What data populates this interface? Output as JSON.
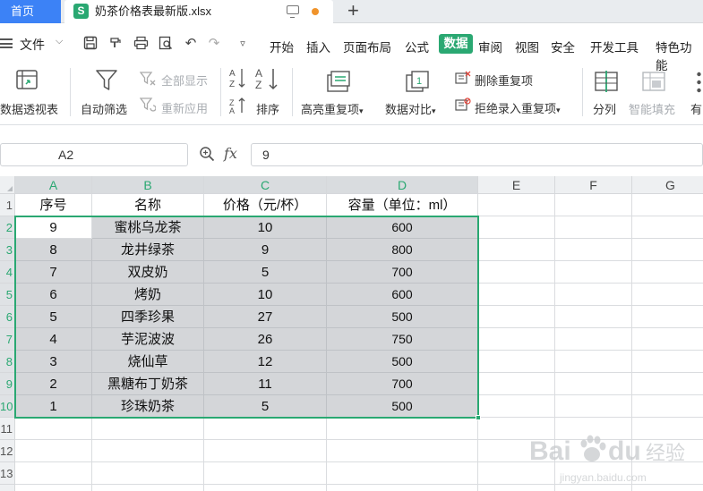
{
  "tabs": {
    "home_label": "首页",
    "file_icon_letter": "S",
    "file_name": "奶茶价格表最新版.xlsx",
    "new_tab_symbol": "+"
  },
  "menubar": {
    "file_label": "文件",
    "items": [
      "开始",
      "插入",
      "页面布局",
      "公式",
      "数据",
      "审阅",
      "视图",
      "安全",
      "开发工具",
      "特色功能"
    ],
    "active_item": "数据"
  },
  "ribbon": {
    "pivot_label": "数据透视表",
    "autofilter_label": "自动筛选",
    "show_all_label": "全部显示",
    "reapply_label": "重新应用",
    "sort_label": "排序",
    "highlight_dup_label": "高亮重复项",
    "compare_label": "数据对比",
    "remove_dup_label": "删除重复项",
    "reject_dup_label": "拒绝录入重复项",
    "split_label": "分列",
    "smart_fill_label": "智能填充",
    "more_label": "有",
    "dropdown_glyph": "▾"
  },
  "formula_bar": {
    "cell_ref": "A2",
    "fx_label": "fx",
    "value": "9"
  },
  "sheet": {
    "column_letters": [
      "A",
      "B",
      "C",
      "D",
      "E",
      "F",
      "G"
    ],
    "row_numbers": [
      "1",
      "2",
      "3",
      "4",
      "5",
      "6",
      "7",
      "8",
      "9",
      "10",
      "11",
      "12",
      "13",
      "14"
    ],
    "headers": [
      "序号",
      "名称",
      "价格（元/杯）",
      "容量（单位：ml）"
    ],
    "rows": [
      [
        "9",
        "蜜桃乌龙茶",
        "10",
        "600"
      ],
      [
        "8",
        "龙井绿茶",
        "9",
        "800"
      ],
      [
        "7",
        "双皮奶",
        "5",
        "700"
      ],
      [
        "6",
        "烤奶",
        "10",
        "600"
      ],
      [
        "5",
        "四季珍果",
        "27",
        "500"
      ],
      [
        "4",
        "芋泥波波",
        "26",
        "750"
      ],
      [
        "3",
        "烧仙草",
        "12",
        "500"
      ],
      [
        "2",
        "黑糖布丁奶茶",
        "11",
        "700"
      ],
      [
        "1",
        "珍珠奶茶",
        "5",
        "500"
      ]
    ],
    "active_cell": "A2",
    "selected_range": "A2:D10"
  },
  "watermark": {
    "text": "Bai du 经验",
    "sub": "jingyan.baidu.com"
  },
  "colors": {
    "accent_green": "#2aa872",
    "tab_blue": "#3c82f6",
    "selection_fill": "#d4d6d9"
  }
}
